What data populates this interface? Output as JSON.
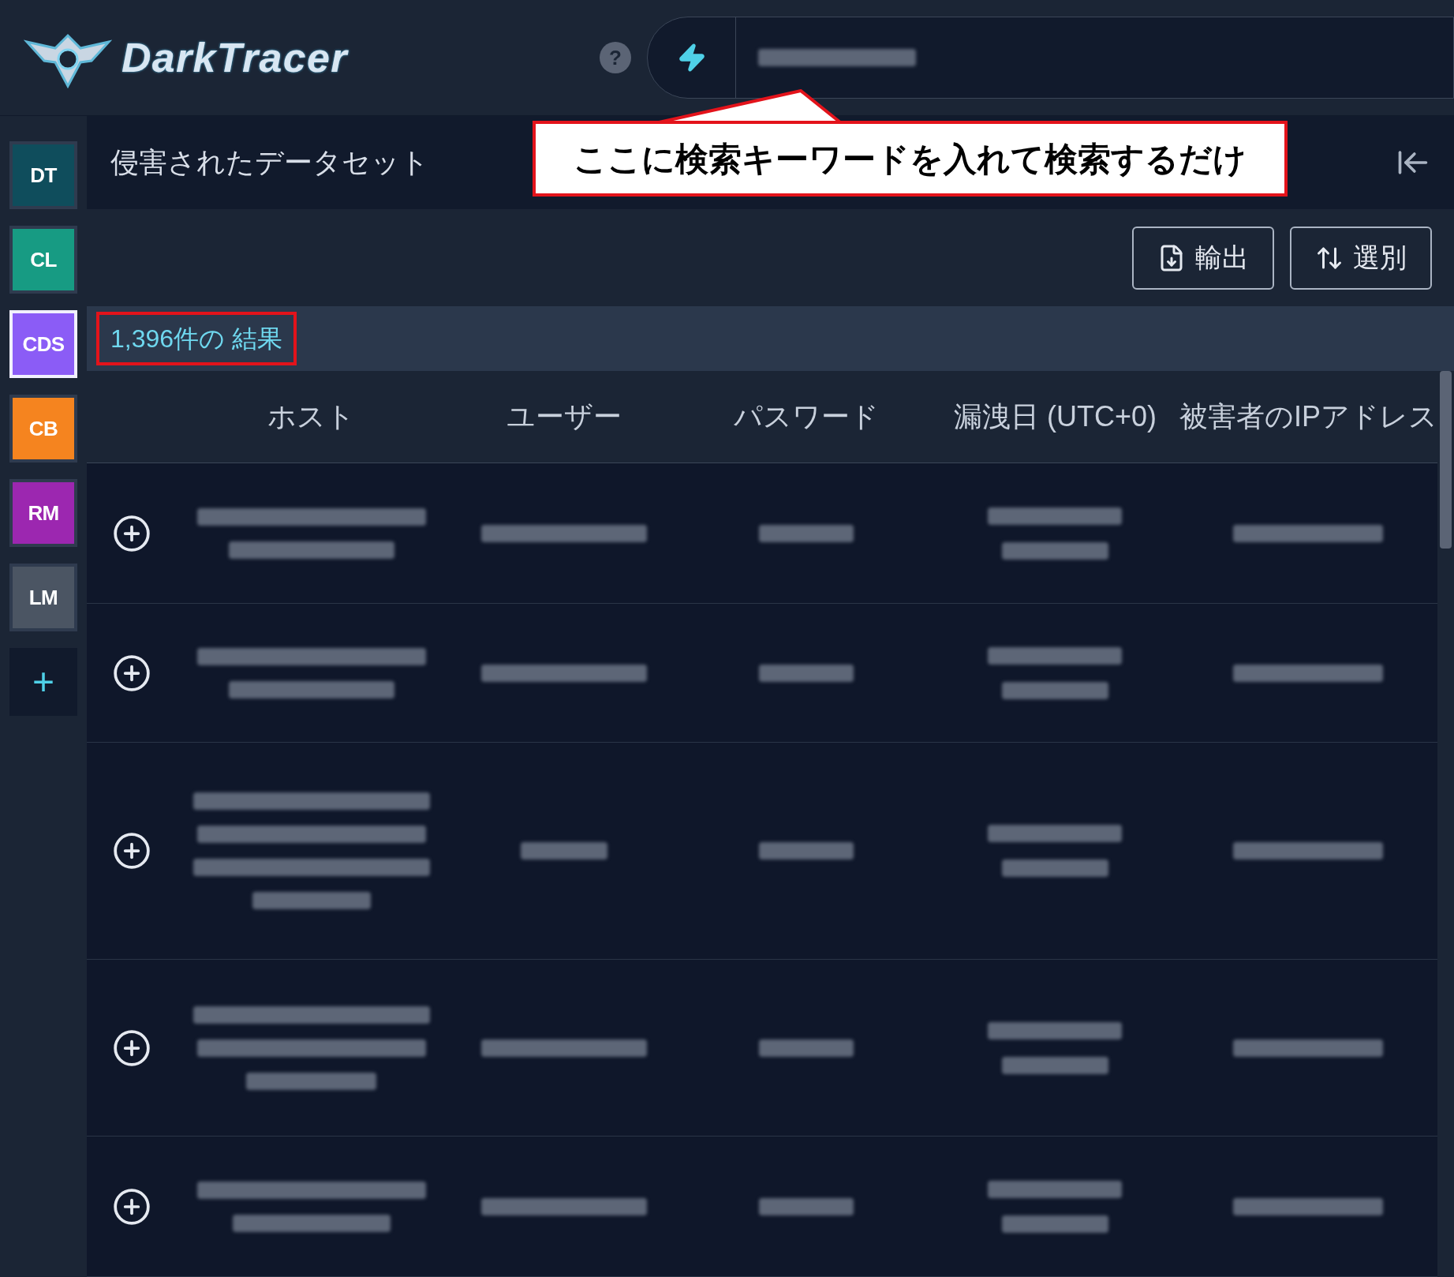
{
  "header": {
    "logo_text": "DarkTracer",
    "help_icon": "?"
  },
  "sidebar": {
    "items": [
      {
        "label": "DT",
        "color": "#0f4d5c",
        "selected": false
      },
      {
        "label": "CL",
        "color": "#179b83",
        "selected": false
      },
      {
        "label": "CDS",
        "color": "#8b5cf6",
        "selected": true
      },
      {
        "label": "CB",
        "color": "#f5841f",
        "selected": false
      },
      {
        "label": "RM",
        "color": "#9c27b0",
        "selected": false
      },
      {
        "label": "LM",
        "color": "#4b5563",
        "selected": false
      }
    ],
    "add_button": "+"
  },
  "page_title": "侵害されたデータセット",
  "callout": "ここに検索キーワードを入れて検索するだけ",
  "toolbar": {
    "buttons": [
      {
        "label": "輸出",
        "kind": "export"
      },
      {
        "label": "選別",
        "kind": "sort"
      }
    ]
  },
  "results_count": "1,396件の 結果",
  "table": {
    "columns": [
      "ホスト",
      "ユーザー",
      "パスワード",
      "漏洩日 (UTC+0)",
      "被害者のIPアドレス"
    ],
    "rows": [
      {
        "expanded": false
      },
      {
        "expanded": false
      },
      {
        "expanded": false
      },
      {
        "expanded": false
      },
      {
        "expanded": false
      }
    ]
  }
}
